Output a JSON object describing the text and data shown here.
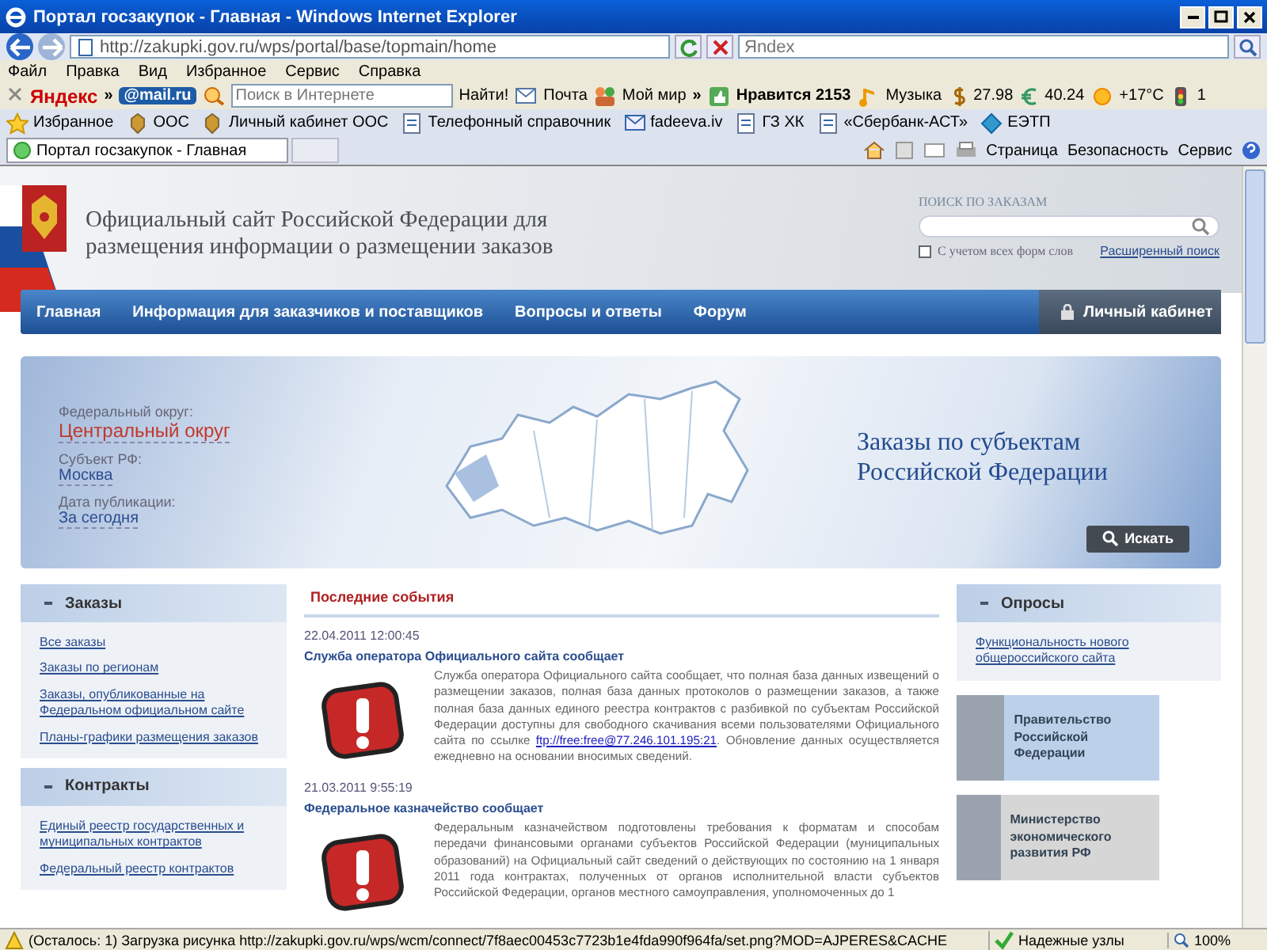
{
  "window": {
    "title": "Портал госзакупок - Главная - Windows Internet Explorer"
  },
  "address_bar": {
    "url": "http://zakupki.gov.ru/wps/portal/base/topmain/home",
    "search_placeholder": "Яndex"
  },
  "menu": [
    "Файл",
    "Правка",
    "Вид",
    "Избранное",
    "Сервис",
    "Справка"
  ],
  "toolbar": [
    {
      "kind": "brand",
      "label": "Яндекс"
    },
    {
      "kind": "chevron",
      "label": "»"
    },
    {
      "kind": "mail",
      "label": "@mail.ru"
    },
    {
      "kind": "search",
      "placeholder": "Поиск в Интернете"
    },
    {
      "kind": "plain",
      "label": "Найти!"
    },
    {
      "kind": "mailbox",
      "label": "Почта"
    },
    {
      "kind": "people",
      "label": "Мой мир"
    },
    {
      "kind": "chevron",
      "label": "»"
    },
    {
      "kind": "like",
      "label": "Нравится 2153"
    },
    {
      "kind": "music",
      "label": "Музыка"
    },
    {
      "kind": "dollar",
      "label": "27.98"
    },
    {
      "kind": "euro",
      "label": "40.24"
    },
    {
      "kind": "sun",
      "label": "+17°C"
    },
    {
      "kind": "traffic",
      "label": "1"
    }
  ],
  "favorites": [
    {
      "kind": "star",
      "label": "Избранное"
    },
    {
      "kind": "emblem",
      "label": "ООС"
    },
    {
      "kind": "emblem",
      "label": "Личный кабинет ООС"
    },
    {
      "kind": "page",
      "label": "Телефонный справочник"
    },
    {
      "kind": "mail",
      "label": "fadeeva.iv"
    },
    {
      "kind": "page",
      "label": "ГЗ ХК"
    },
    {
      "kind": "page",
      "label": "«Сбербанк-АСТ»"
    },
    {
      "kind": "diamond",
      "label": "ЕЭТП"
    }
  ],
  "tab": {
    "title": "Портал госзакупок - Главная"
  },
  "command_bar": [
    "Страница",
    "Безопасность",
    "Сервис"
  ],
  "site": {
    "title": "Официальный сайт Российской Федерации для размещения информации о размещении заказов",
    "search": {
      "label": "ПОИСК ПО ЗАКАЗАМ",
      "option": "С учетом всех форм слов",
      "checked": false,
      "advanced": "Расширенный поиск"
    },
    "nav": [
      {
        "label": "Главная"
      },
      {
        "label": "Информация для заказчиков и поставщиков"
      },
      {
        "label": "Вопросы и ответы"
      },
      {
        "label": "Форум"
      }
    ],
    "cabinet": "Личный кабинет",
    "banner": {
      "fields": [
        {
          "label": "Федеральный округ:",
          "value": "Центральный округ",
          "kind": "accent"
        },
        {
          "label": "Субъект РФ:",
          "value": "Москва",
          "kind": "link"
        },
        {
          "label": "Дата публикации:",
          "value": "За сегодня",
          "kind": "link"
        }
      ],
      "title": "Заказы по субъектам Российской Федерации",
      "button": "Искать"
    },
    "sidebar": [
      {
        "title": "Заказы",
        "links": [
          "Все заказы",
          "Заказы по регионам",
          "Заказы, опубликованные на Федеральном официальном сайте",
          "Планы-графики размещения заказов"
        ]
      },
      {
        "title": "Контракты",
        "links": [
          "Единый реестр государственных и муниципальных контрактов",
          "Федеральный реестр контрактов"
        ]
      }
    ],
    "news": {
      "title": "Последние события",
      "items": [
        {
          "date": "22.04.2011 12:00:45",
          "headline": "Служба оператора Официального сайта сообщает",
          "text": "Служба оператора Официального сайта сообщает, что полная база данных извещений о размещении заказов, полная база данных протоколов о размещении заказов, а также полная база данных единого реестра контрактов с разбивкой по субъектам Российской Федерации доступны для свободного скачивания всеми пользователями Официального сайта по ссылке",
          "link": "ftp://free:free@77.246.101.195:21",
          "text_after": ". Обновление данных осуществляется ежедневно на основании вносимых сведений."
        },
        {
          "date": "21.03.2011 9:55:19",
          "headline": "Федеральное казначейство сообщает",
          "text": "Федеральным казначейством подготовлены требования к форматам и способам передачи финансовыми органами субъектов Российской Федерации (муниципальных образований) на Официальный сайт сведений о действующих по состоянию на 1 января 2011 года контрактах, полученных от органов исполнительной власти субъектов Российской Федерации, органов местного самоуправления, уполномоченных до 1"
        }
      ]
    },
    "polls": {
      "title": "Опросы",
      "links": [
        "Функциональность нового общероссийского сайта"
      ]
    },
    "promos": [
      {
        "label": "Правительство Российской Федерации",
        "kind": "blue"
      },
      {
        "label": "Министерство экономического развития РФ",
        "kind": "grey"
      }
    ]
  },
  "status_bar": {
    "text": "(Осталось: 1) Загрузка рисунка http://zakupki.gov.ru/wps/wcm/connect/7f8aec00453c7723b1e4fda990f964fa/set.png?MOD=AJPERES&CACHE",
    "zone": "Надежные узлы",
    "zoom": "100%"
  }
}
